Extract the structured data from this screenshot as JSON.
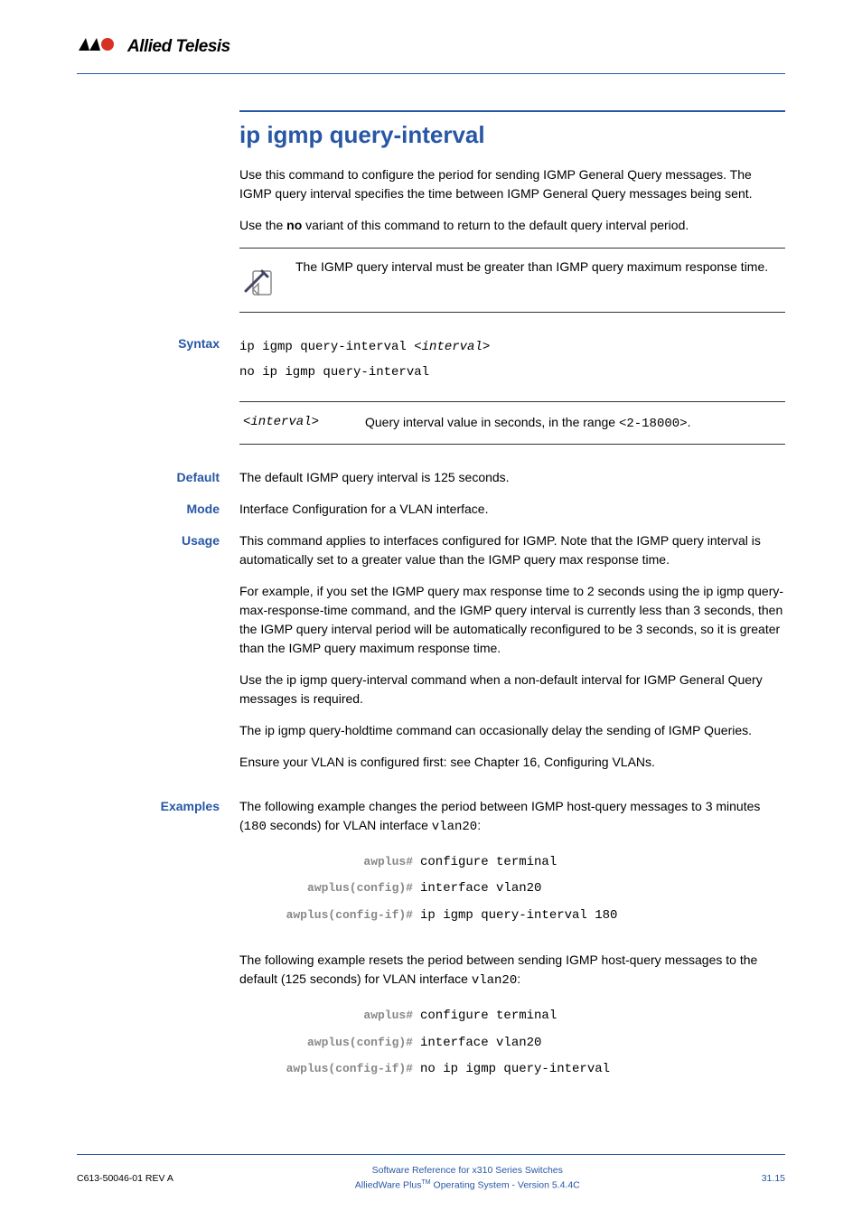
{
  "header": {
    "brand": "Allied Telesis"
  },
  "title": "ip igmp query-interval",
  "intro": {
    "p1": "Use this command to configure the period for sending IGMP General Query messages. The IGMP query interval specifies the time between IGMP General Query messages being sent.",
    "p2_pre": "Use the ",
    "p2_bold": "no",
    "p2_post": " variant of this command to return to the default query interval period."
  },
  "note": "The IGMP query interval must be greater than IGMP query maximum response time.",
  "syntax": {
    "label": "Syntax",
    "line1_pre": "ip igmp query-interval <",
    "line1_param": "interval",
    "line1_post": ">",
    "line2": "no ip igmp query-interval"
  },
  "param": {
    "name": "<interval>",
    "desc_pre": "Query interval value in seconds, in the range ",
    "desc_code": "<2-18000>",
    "desc_post": "."
  },
  "default": {
    "label": "Default",
    "text": "The default IGMP query interval is 125 seconds."
  },
  "mode": {
    "label": "Mode",
    "text": "Interface Configuration for a VLAN interface."
  },
  "usage": {
    "label": "Usage",
    "p1": "This command applies to interfaces configured for IGMP. Note that the IGMP query interval is automatically set to a greater value than the IGMP query max response time.",
    "p2_pre": "For example, if you set the IGMP query max response time to 2 seconds using the ",
    "p2_link": "ip igmp query-max-response-time",
    "p2_post": " command, and the IGMP query interval is currently less than 3 seconds, then the IGMP query interval period will be automatically reconfigured to be 3 seconds, so it is greater than the IGMP query maximum response time.",
    "p3_pre": "Use the ",
    "p3_bold": "ip igmp query-interval",
    "p3_post": " command when a non-default interval for IGMP General Query messages is required.",
    "p4_pre": "The ",
    "p4_link": "ip igmp query-holdtime",
    "p4_post": " command can occasionally delay the sending of IGMP Queries.",
    "p5_pre": "Ensure your VLAN is configured first: see ",
    "p5_link": "Chapter 16, Configuring VLANs",
    "p5_post": "."
  },
  "examples": {
    "label": "Examples",
    "intro1_pre": "The following example changes the period between IGMP host-query messages to 3 minutes (",
    "intro1_code1": "180",
    "intro1_mid": " seconds) for VLAN interface ",
    "intro1_code2": "vlan20",
    "intro1_post": ":",
    "cli1": {
      "prompt1": "awplus#",
      "cmd1": "configure terminal",
      "prompt2": "awplus(config)#",
      "cmd2": "interface vlan20",
      "prompt3": "awplus(config-if)#",
      "cmd3": "ip igmp query-interval 180"
    },
    "intro2_pre": "The following example resets the period between sending IGMP host-query messages to the default (125 seconds) for VLAN interface ",
    "intro2_code": "vlan20",
    "intro2_post": ":",
    "cli2": {
      "prompt1": "awplus#",
      "cmd1": "configure terminal",
      "prompt2": "awplus(config)#",
      "cmd2": "interface vlan20",
      "prompt3": "awplus(config-if)#",
      "cmd3": "no ip igmp query-interval"
    }
  },
  "footer": {
    "left": "C613-50046-01 REV A",
    "center_line1": "Software Reference for x310 Series Switches",
    "center_line2_pre": "AlliedWare Plus",
    "center_line2_tm": "TM",
    "center_line2_post": " Operating System - Version 5.4.4C",
    "right": "31.15"
  }
}
